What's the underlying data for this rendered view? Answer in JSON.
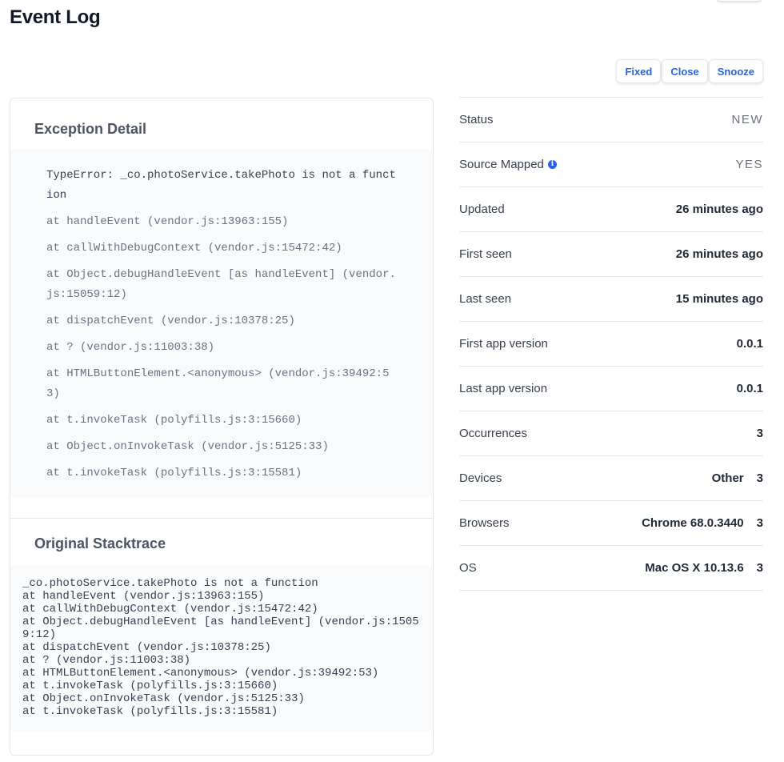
{
  "page": {
    "title": "Event Log"
  },
  "actions": {
    "fixed": "Fixed",
    "close": "Close",
    "snooze": "Snooze"
  },
  "exception": {
    "title": "Exception Detail",
    "lines": [
      "TypeError: _co.photoService.takePhoto is not a function",
      "at handleEvent (vendor.js:13963:155)",
      "at callWithDebugContext (vendor.js:15472:42)",
      "at Object.debugHandleEvent [as handleEvent] (vendor.js:15059:12)",
      "at dispatchEvent (vendor.js:10378:25)",
      "at ? (vendor.js:11003:38)",
      "at HTMLButtonElement.<anonymous> (vendor.js:39492:53)",
      "at t.invokeTask (polyfills.js:3:15660)",
      "at Object.onInvokeTask (vendor.js:5125:33)",
      "at t.invokeTask (polyfills.js:3:15581)"
    ]
  },
  "original": {
    "title": "Original Stacktrace",
    "lines": [
      "_co.photoService.takePhoto is not a function",
      "at handleEvent (vendor.js:13963:155)",
      "at callWithDebugContext (vendor.js:15472:42)",
      "at Object.debugHandleEvent [as handleEvent] (vendor.js:15059:12)",
      "at dispatchEvent (vendor.js:10378:25)",
      "at ? (vendor.js:11003:38)",
      "at HTMLButtonElement.<anonymous> (vendor.js:39492:53)",
      "at t.invokeTask (polyfills.js:3:15660)",
      "at Object.onInvokeTask (vendor.js:5125:33)",
      "at t.invokeTask (polyfills.js:3:15581)"
    ]
  },
  "meta": {
    "status": {
      "label": "Status",
      "value": "NEW"
    },
    "source_mapped": {
      "label": "Source Mapped",
      "value": "YES",
      "icon": "info-icon"
    },
    "updated": {
      "label": "Updated",
      "value": "26 minutes ago"
    },
    "first_seen": {
      "label": "First seen",
      "value": "26 minutes ago"
    },
    "last_seen": {
      "label": "Last seen",
      "value": "15 minutes ago"
    },
    "first_app_version": {
      "label": "First app version",
      "value": "0.0.1"
    },
    "last_app_version": {
      "label": "Last app version",
      "value": "0.0.1"
    },
    "occurrences": {
      "label": "Occurrences",
      "value": "3"
    },
    "devices": {
      "label": "Devices",
      "value": "Other",
      "count": "3"
    },
    "browsers": {
      "label": "Browsers",
      "value": "Chrome 68.0.3440",
      "count": "3"
    },
    "os": {
      "label": "OS",
      "value": "Mac OS X 10.13.6",
      "count": "3"
    }
  },
  "colors": {
    "accent": "#2563eb",
    "code_bg": "#f8fafc",
    "border": "#e5e7eb"
  }
}
